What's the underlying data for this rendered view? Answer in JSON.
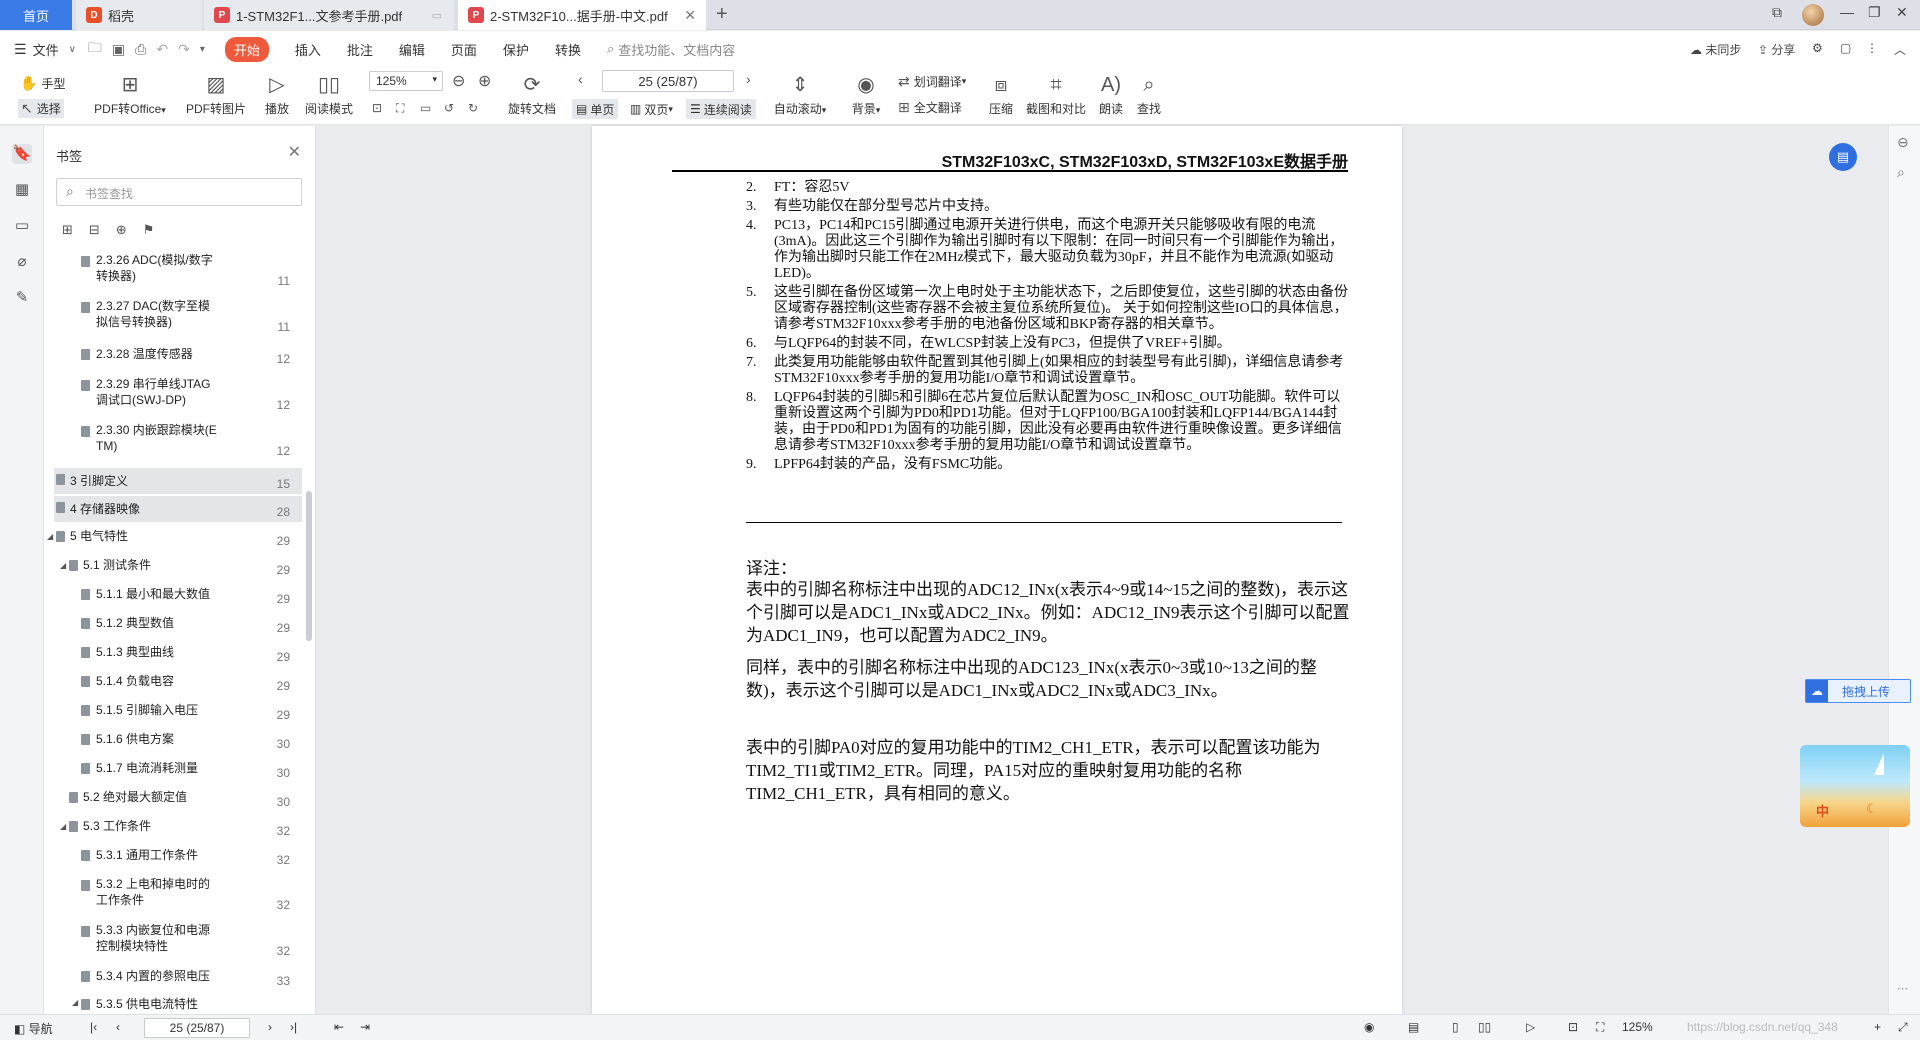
{
  "tabs": {
    "home": "首页",
    "draft": "稻壳",
    "doc1": "1-STM32F1...文参考手册.pdf",
    "doc2": "2-STM32F10...据手册-中文.pdf"
  },
  "menu": {
    "file": "文件",
    "start": "开始",
    "insert": "插入",
    "annotate": "批注",
    "edit": "编辑",
    "page": "页面",
    "protect": "保护",
    "convert": "转换",
    "search_placeholder": "查找功能、文档内容",
    "sync": "未同步",
    "share": "分享"
  },
  "ribbon": {
    "hand": "手型",
    "select": "选择",
    "pdf_to_office": "PDF转Office",
    "pdf_to_image": "PDF转图片",
    "play": "播放",
    "read_mode": "阅读模式",
    "zoom": "125%",
    "rotate": "旋转文档",
    "page_indicator": "25 (25/87)",
    "single": "单页",
    "double": "双页",
    "continuous": "连续阅读",
    "auto_scroll": "自动滚动",
    "background": "背景",
    "word_translate": "划词翻译",
    "full_translate": "全文翻译",
    "compress": "压缩",
    "screenshot_compare": "截图和对比",
    "read_aloud": "朗读",
    "find": "查找"
  },
  "bookmarks": {
    "title": "书签",
    "search_placeholder": "书签查找",
    "items": [
      {
        "label1": "2.3.26 ADC(模拟/数字",
        "label2": "转换器)",
        "page": "11"
      },
      {
        "label1": "2.3.27 DAC(数字至模",
        "label2": "拟信号转换器)",
        "page": "11"
      },
      {
        "label1": "2.3.28 温度传感器",
        "page": "12"
      },
      {
        "label1": "2.3.29 串行单线JTAG",
        "label2": "调试口(SWJ-DP)",
        "page": "12"
      },
      {
        "label1": "2.3.30 内嵌跟踪模块(E",
        "label2": "TM)",
        "page": "12"
      },
      {
        "label1": "3 引脚定义",
        "page": "15"
      },
      {
        "label1": "4 存储器映像",
        "page": "28"
      },
      {
        "label1": "5 电气特性",
        "page": "29"
      },
      {
        "label1": "5.1 测试条件",
        "page": "29"
      },
      {
        "label1": "5.1.1 最小和最大数值",
        "page": "29"
      },
      {
        "label1": "5.1.2 典型数值",
        "page": "29"
      },
      {
        "label1": "5.1.3 典型曲线",
        "page": "29"
      },
      {
        "label1": "5.1.4 负载电容",
        "page": "29"
      },
      {
        "label1": "5.1.5 引脚输入电压",
        "page": "29"
      },
      {
        "label1": "5.1.6 供电方案",
        "page": "30"
      },
      {
        "label1": "5.1.7 电流消耗测量",
        "page": "30"
      },
      {
        "label1": "5.2 绝对最大额定值",
        "page": "30"
      },
      {
        "label1": "5.3 工作条件",
        "page": "32"
      },
      {
        "label1": "5.3.1 通用工作条件",
        "page": "32"
      },
      {
        "label1": "5.3.2 上电和掉电时的",
        "label2": "工作条件",
        "page": "32"
      },
      {
        "label1": "5.3.3 内嵌复位和电源",
        "label2": "控制模块特性",
        "page": "32"
      },
      {
        "label1": "5.3.4 内置的参照电压",
        "page": "33"
      },
      {
        "label1": "5.3.5 供电电流特性",
        "page": ""
      }
    ]
  },
  "document": {
    "header": "STM32F103xC, STM32F103xD, STM32F103xE数据手册",
    "notes": [
      {
        "num": "2.",
        "text": "FT：容忍5V"
      },
      {
        "num": "3.",
        "text": "有些功能仅在部分型号芯片中支持。"
      },
      {
        "num": "4.",
        "text": "PC13，PC14和PC15引脚通过电源开关进行供电，而这个电源开关只能够吸收有限的电流(3mA)。因此这三个引脚作为输出引脚时有以下限制：在同一时间只有一个引脚能作为输出，作为输出脚时只能工作在2MHz模式下，最大驱动负载为30pF，并且不能作为电流源(如驱动LED)。"
      },
      {
        "num": "5.",
        "text": "这些引脚在备份区域第一次上电时处于主功能状态下，之后即使复位，这些引脚的状态由备份区域寄存器控制(这些寄存器不会被主复位系统所复位)。 关于如何控制这些IO口的具体信息，请参考STM32F10xxx参考手册的电池备份区域和BKP寄存器的相关章节。"
      },
      {
        "num": "6.",
        "text": "与LQFP64的封装不同，在WLCSP封装上没有PC3，但提供了VREF+引脚。"
      },
      {
        "num": "7.",
        "text": "此类复用功能能够由软件配置到其他引脚上(如果相应的封装型号有此引脚)，详细信息请参考STM32F10xxx参考手册的复用功能I/O章节和调试设置章节。"
      },
      {
        "num": "8.",
        "text": "LQFP64封装的引脚5和引脚6在芯片复位后默认配置为OSC_IN和OSC_OUT功能脚。软件可以重新设置这两个引脚为PD0和PD1功能。但对于LQFP100/BGA100封装和LQFP144/BGA144封装，由于PD0和PD1为固有的功能引脚，因此没有必要再由软件进行重映像设置。更多详细信息请参考STM32F10xxx参考手册的复用功能I/O章节和调试设置章节。"
      },
      {
        "num": "9.",
        "text": "LPFP64封装的产品，没有FSMC功能。"
      }
    ],
    "translator_note_title": "译注：",
    "translator_paragraphs": [
      "表中的引脚名称标注中出现的ADC12_INx(x表示4~9或14~15之间的整数)，表示这个引脚可以是ADC1_INx或ADC2_INx。例如：ADC12_IN9表示这个引脚可以配置为ADC1_IN9，也可以配置为ADC2_IN9。",
      "同样，表中的引脚名称标注中出现的ADC123_INx(x表示0~3或10~13之间的整数)，表示这个引脚可以是ADC1_INx或ADC2_INx或ADC3_INx。",
      "表中的引脚PA0对应的复用功能中的TIM2_CH1_ETR，表示可以配置该功能为TIM2_TI1或TIM2_ETR。同理，PA15对应的重映射复用功能的名称TIM2_CH1_ETR，具有相同的意义。"
    ]
  },
  "widgets": {
    "upload": "拖拽上传",
    "promo_text": "中"
  },
  "statusbar": {
    "nav": "导航",
    "page": "25 (25/87)",
    "zoom": "125%",
    "watermark": "https://blog.csdn.net/qq_348"
  }
}
